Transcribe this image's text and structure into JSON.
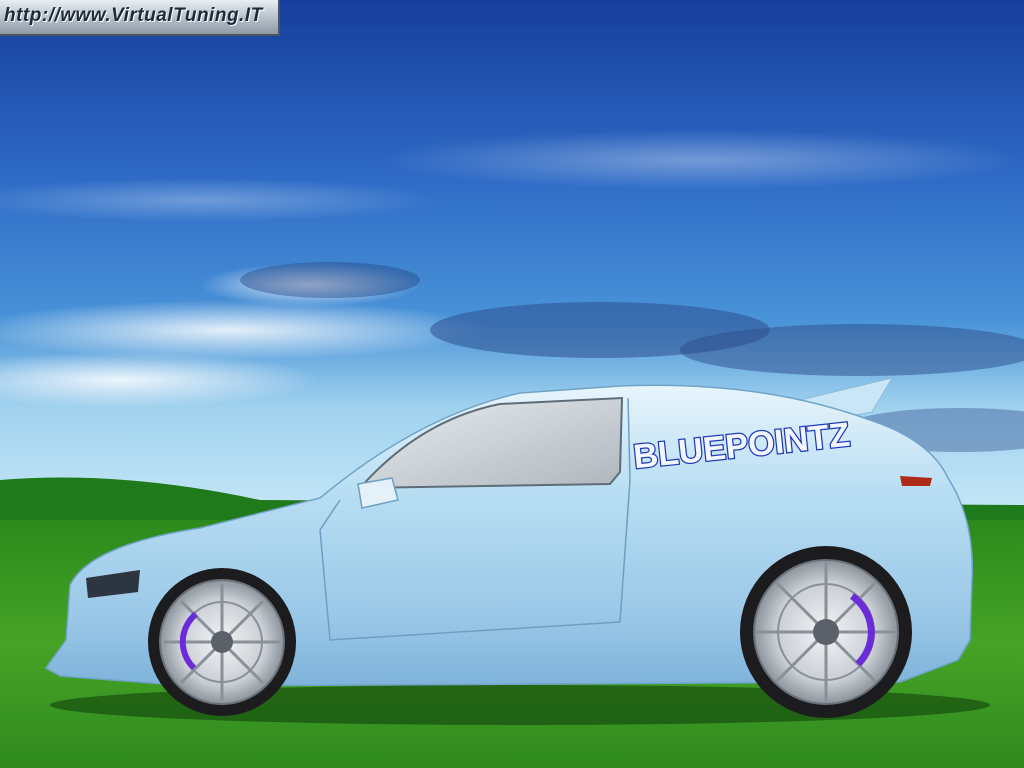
{
  "watermark": {
    "text": "http://www.VirtualTuning.IT"
  },
  "car": {
    "decal_text": "BLUEPOINTZ"
  },
  "colors": {
    "sky_top": "#1c4fb0",
    "sky_mid": "#3b7fd2",
    "sky_horizon": "#9fd1ee",
    "hills": "#1f7d1f",
    "grass": "#3f9b22",
    "car_body": "#b7dcf2",
    "car_shadow": "#6fa5cc",
    "rims": "#d7dbe0",
    "decal": "#1f3ab8"
  },
  "icons": [
    "car-illustration",
    "wheel-icon",
    "mirror-icon"
  ]
}
